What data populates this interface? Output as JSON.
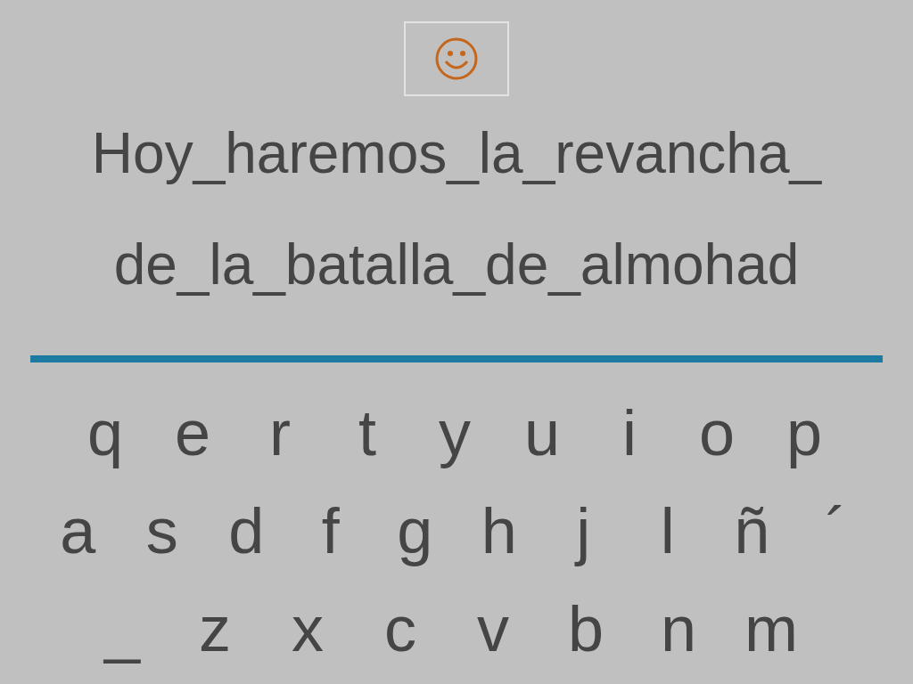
{
  "sentence": [
    "Hoy_haremos_la_revancha_",
    "de_la_batalla_de_almohad"
  ],
  "keyboard": [
    [
      "q",
      "e",
      "r",
      "t",
      "y",
      "u",
      "i",
      "o",
      "p"
    ],
    [
      "a",
      "s",
      "d",
      "f",
      "g",
      "h",
      "j",
      "l",
      "ñ",
      "´"
    ],
    [
      "_",
      "z",
      "x",
      "c",
      "v",
      "b",
      "n",
      "m"
    ]
  ]
}
